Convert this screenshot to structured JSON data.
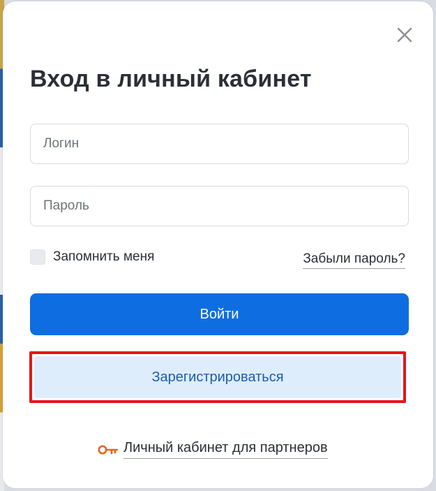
{
  "modal": {
    "title": "Вход в личный кабинет",
    "close_icon": "close-icon"
  },
  "form": {
    "login_placeholder": "Логин",
    "login_value": "",
    "password_placeholder": "Пароль",
    "password_value": "",
    "remember_label": "Запомнить меня",
    "remember_checked": false,
    "forgot_label": "Забыли пароль?",
    "submit_label": "Войти",
    "register_label": "Зарегистрироваться",
    "partner_icon": "key-icon",
    "partner_label": "Личный кабинет для партнеров"
  },
  "colors": {
    "primary": "#0e6ee1",
    "register_bg": "#deedfc",
    "register_text": "#1a5db3",
    "highlight": "#e8141c",
    "key_icon": "#e8641c"
  }
}
